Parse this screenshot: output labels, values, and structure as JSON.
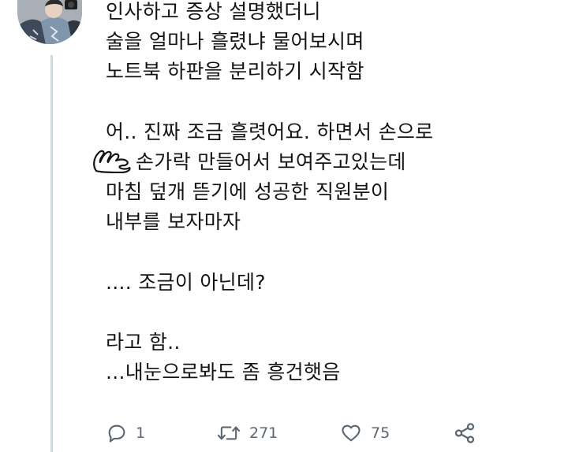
{
  "tweet": {
    "lines": [
      "인사하고 증상 설명했더니",
      "술을 얼마나 흘렸냐 물어보시며",
      "노트북 하판을 분리하기 시작함",
      "",
      "어.. 진짜 조금 흘렷어요. 하면서 손으로",
      "손가락 만들어서 보여주고있는데",
      "마침 덮개 뜯기에 성공한 직원분이",
      "내부를 보자마자",
      "",
      ".... 조금이 아닌데?",
      "",
      "라고 함..",
      "...내눈으로봐도 좀 흥건햇음"
    ]
  },
  "actions": {
    "reply_count": "1",
    "retweet_count": "271",
    "like_count": "75",
    "icons": [
      "reply-icon",
      "retweet-icon",
      "like-icon",
      "share-icon"
    ]
  },
  "colors": {
    "text": "#141414",
    "icon": "#5b6670",
    "thread_line": "#cfd9de"
  }
}
